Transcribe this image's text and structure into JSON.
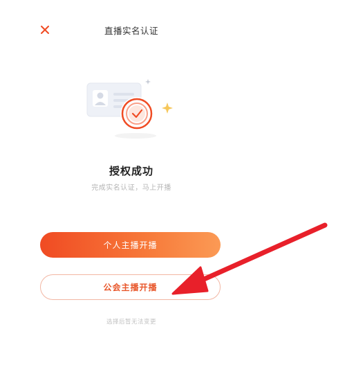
{
  "header": {
    "close_icon": "close-icon",
    "title": "直播实名认证"
  },
  "illustration": {
    "icon": "id-card-verified-icon",
    "colors": {
      "card": "#eef1f7",
      "badge": "#f04b23",
      "check": "#f04b23",
      "sparkle": "#f6c75a"
    }
  },
  "result": {
    "title": "授权成功",
    "subtitle": "完成实名认证，马上开播"
  },
  "actions": {
    "personal_label": "个人主播开播",
    "guild_label": "公会主播开播"
  },
  "footnote": "选择后暂无法变更",
  "colors": {
    "accent": "#f04b23",
    "accent_light": "#fb9a55",
    "secondary_text": "#e8562a",
    "annotation_arrow": "#e8202a"
  }
}
